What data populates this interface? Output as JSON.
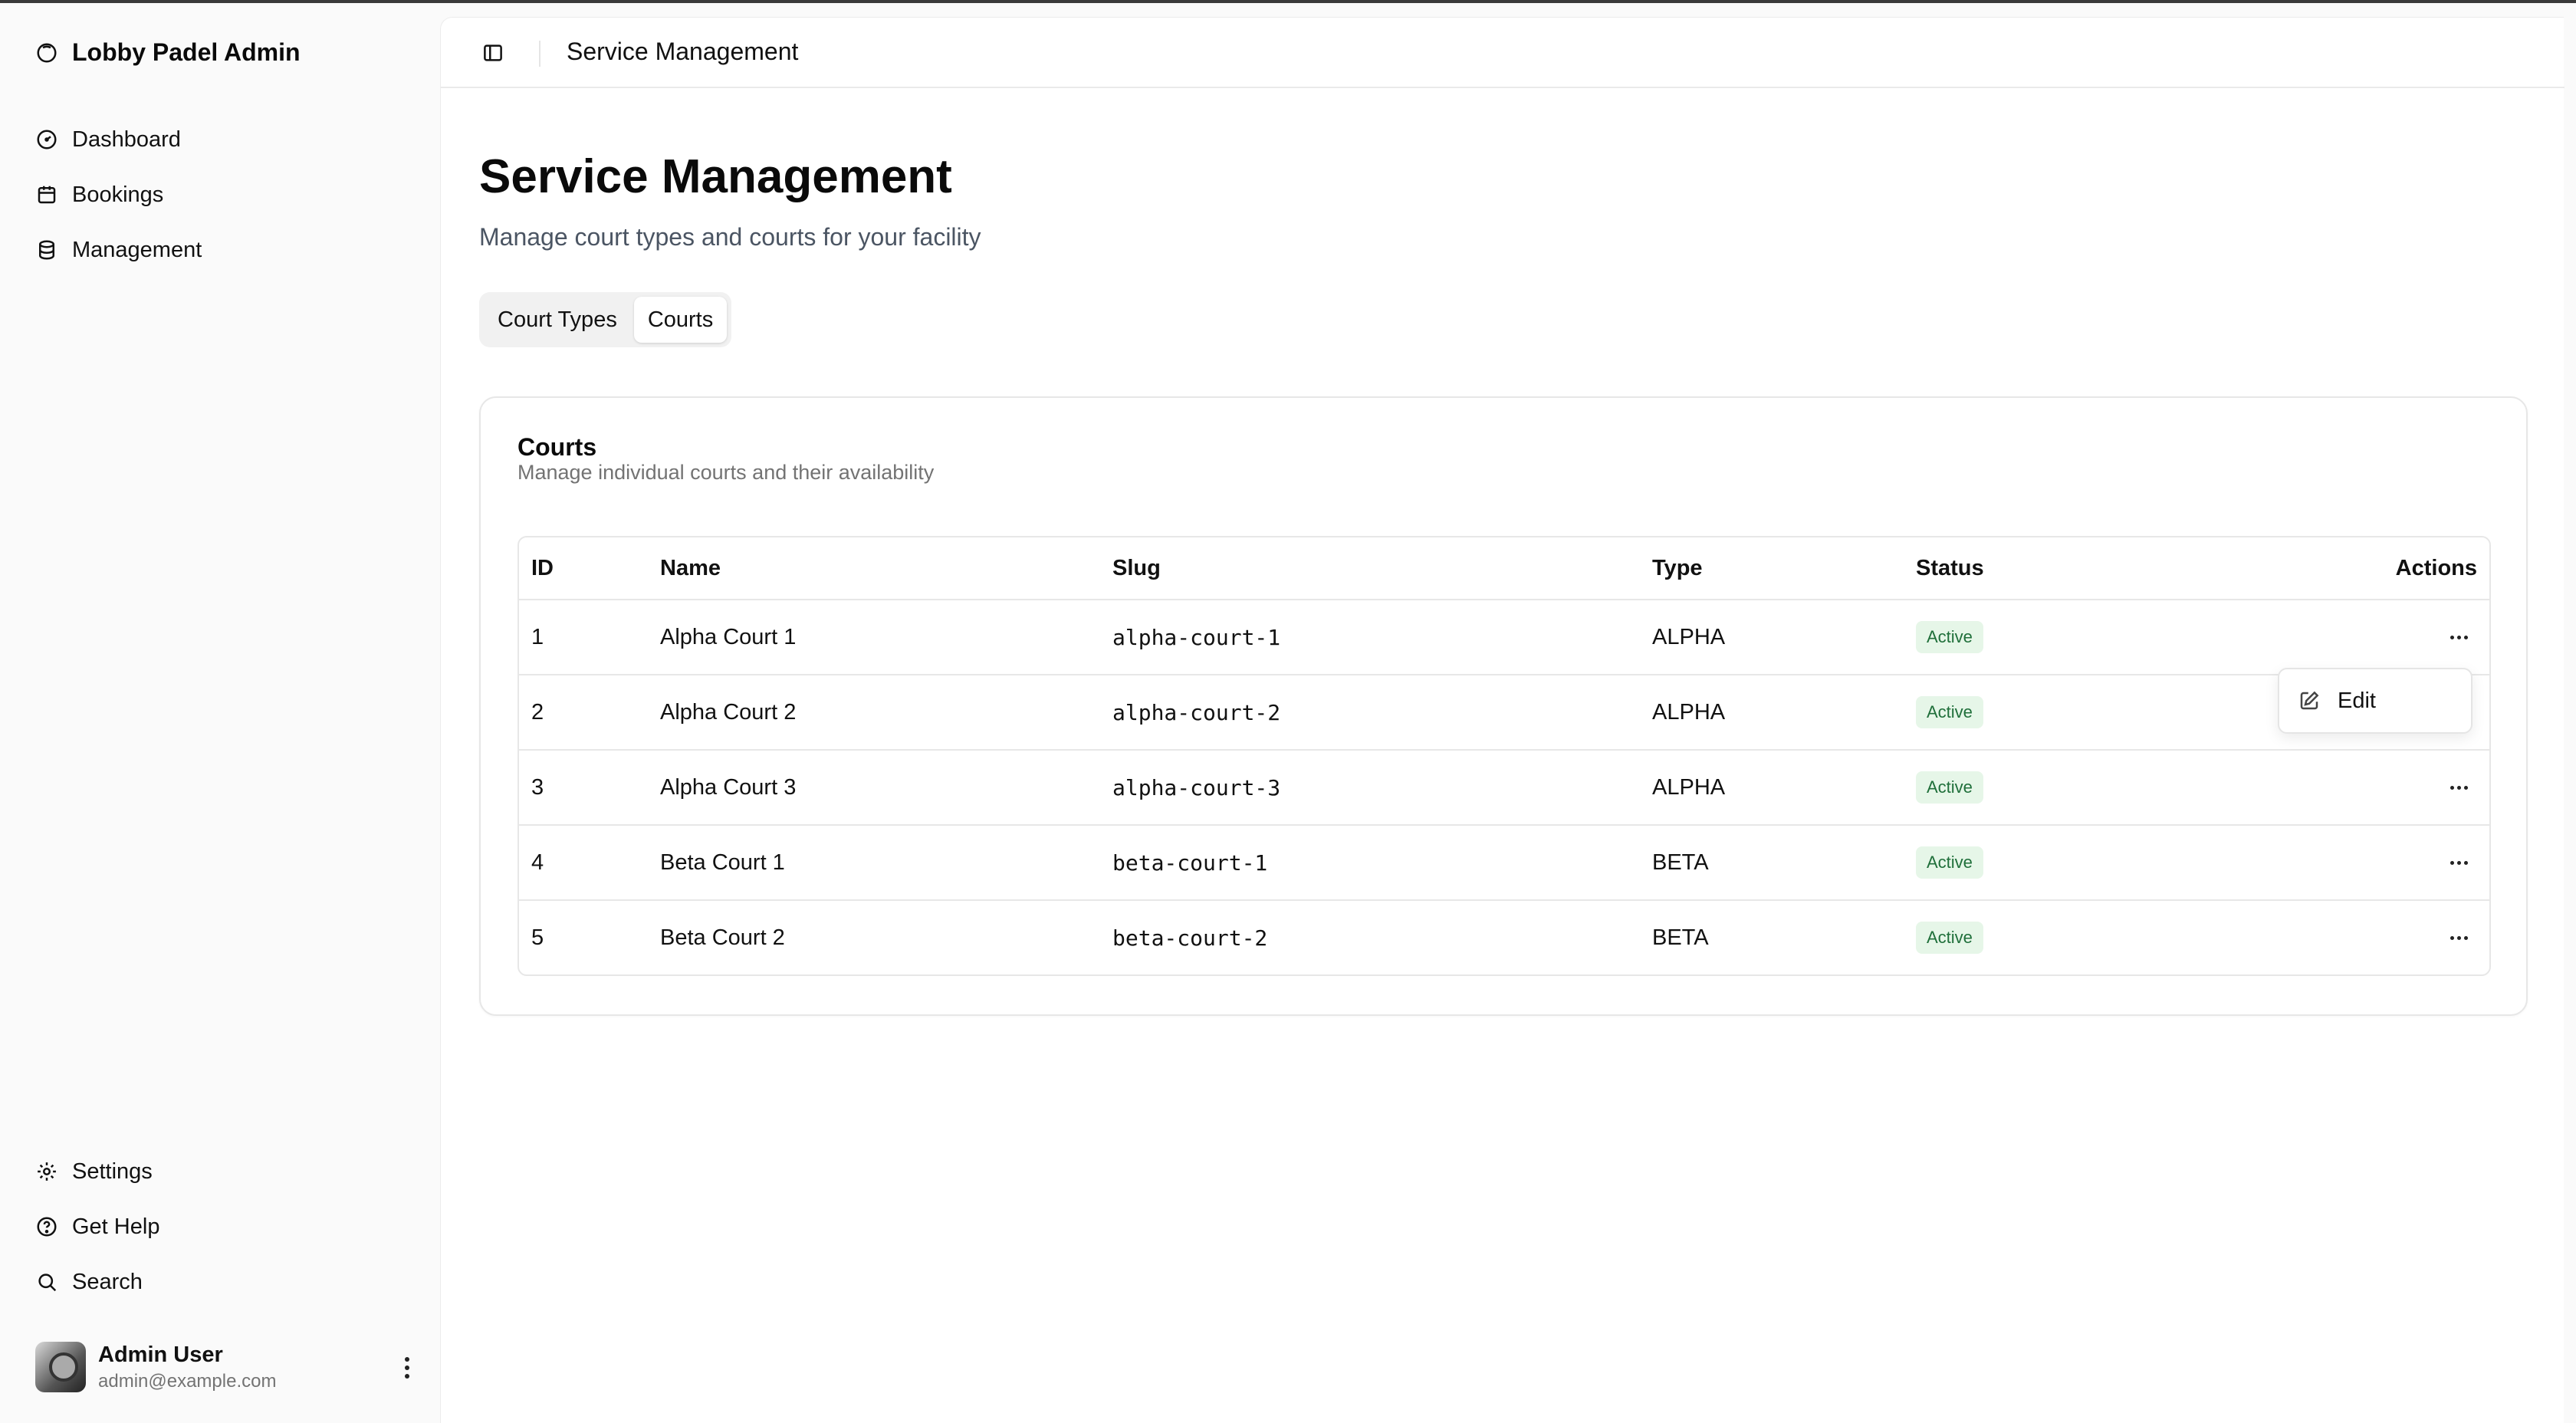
{
  "app": {
    "title": "Lobby Padel Admin"
  },
  "sidebar": {
    "items": [
      {
        "label": "Dashboard",
        "icon": "gauge-icon"
      },
      {
        "label": "Bookings",
        "icon": "calendar-icon"
      },
      {
        "label": "Management",
        "icon": "database-icon"
      }
    ],
    "footer_items": [
      {
        "label": "Settings",
        "icon": "gear-icon"
      },
      {
        "label": "Get Help",
        "icon": "help-circle-icon"
      },
      {
        "label": "Search",
        "icon": "search-icon"
      }
    ],
    "user": {
      "name": "Admin User",
      "email": "admin@example.com"
    }
  },
  "header": {
    "title": "Service Management"
  },
  "page": {
    "title": "Service Management",
    "subtitle": "Manage court types and courts for your facility"
  },
  "tabs": [
    {
      "label": "Court Types",
      "active": false
    },
    {
      "label": "Courts",
      "active": true
    }
  ],
  "card": {
    "title": "Courts",
    "subtitle": "Manage individual courts and their availability"
  },
  "table": {
    "columns": [
      "ID",
      "Name",
      "Slug",
      "Type",
      "Status",
      "Actions"
    ],
    "rows": [
      {
        "id": "1",
        "name": "Alpha Court 1",
        "slug": "alpha-court-1",
        "type": "ALPHA",
        "status": "Active"
      },
      {
        "id": "2",
        "name": "Alpha Court 2",
        "slug": "alpha-court-2",
        "type": "ALPHA",
        "status": "Active"
      },
      {
        "id": "3",
        "name": "Alpha Court 3",
        "slug": "alpha-court-3",
        "type": "ALPHA",
        "status": "Active"
      },
      {
        "id": "4",
        "name": "Beta Court 1",
        "slug": "beta-court-1",
        "type": "BETA",
        "status": "Active"
      },
      {
        "id": "5",
        "name": "Beta Court 2",
        "slug": "beta-court-2",
        "type": "BETA",
        "status": "Active"
      }
    ]
  },
  "dropdown": {
    "label": "Edit",
    "icon": "edit-icon"
  },
  "colors": {
    "status_bg": "#e6f6e8",
    "status_text": "#1f6f3a",
    "sidebar_bg": "#fafafa"
  }
}
